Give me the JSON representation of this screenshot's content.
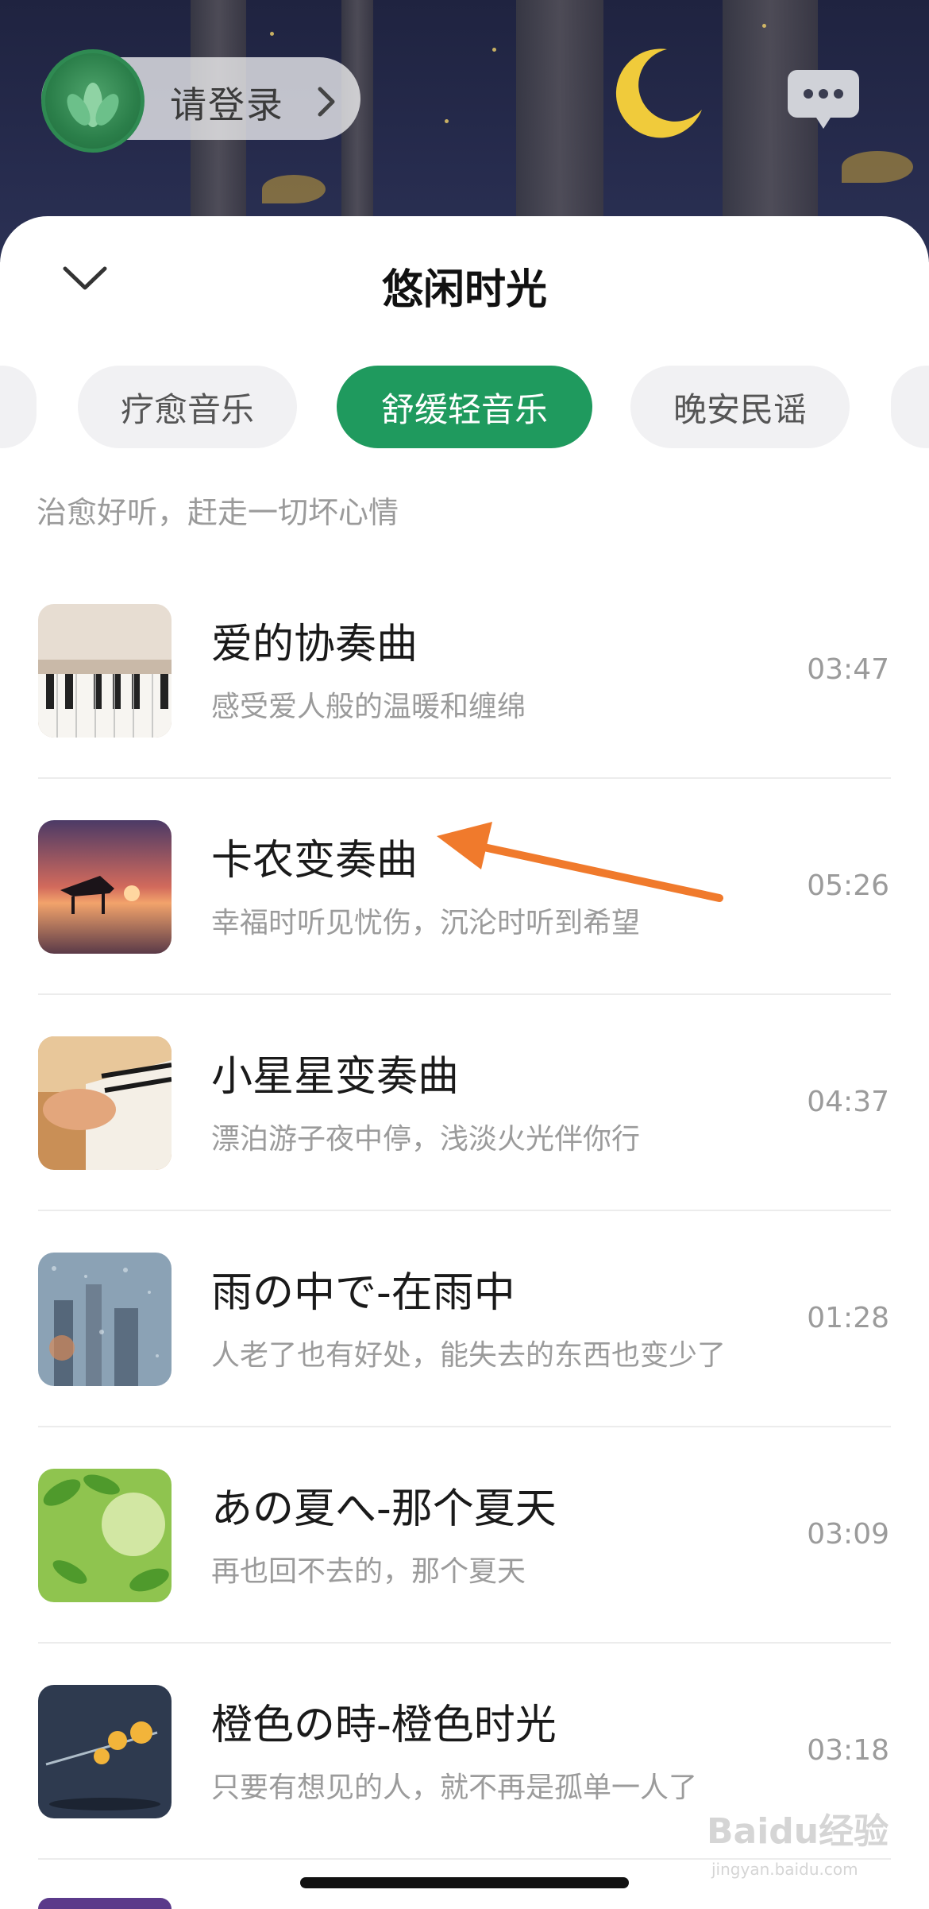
{
  "header": {
    "login_label": "请登录",
    "icons": [
      "lotus-avatar-icon",
      "chevron-right-icon",
      "message-icon",
      "moon-icon"
    ]
  },
  "sheet": {
    "title": "悠闲时光",
    "collapse_icon": "chevron-down-icon"
  },
  "tabs": [
    {
      "label": "",
      "active": false
    },
    {
      "label": "疗愈音乐",
      "active": false
    },
    {
      "label": "舒缓轻音乐",
      "active": true
    },
    {
      "label": "晚安民谣",
      "active": false
    },
    {
      "label": "",
      "active": false
    }
  ],
  "category_subtitle": "治愈好听，赶走一切坏心情",
  "songs": [
    {
      "title": "爱的协奏曲",
      "desc": "感受爱人般的温暖和缠绵",
      "duration": "03:47"
    },
    {
      "title": "卡农变奏曲",
      "desc": "幸福时听见忧伤，沉沦时听到希望",
      "duration": "05:26"
    },
    {
      "title": "小星星变奏曲",
      "desc": "漂泊游子夜中停，浅淡火光伴你行",
      "duration": "04:37"
    },
    {
      "title": "雨の中で-在雨中",
      "desc": "人老了也有好处，能失去的东西也变少了",
      "duration": "01:28"
    },
    {
      "title": "あの夏へ-那个夏天",
      "desc": "再也回不去的，那个夏天",
      "duration": "03:09"
    },
    {
      "title": "橙色の時-橙色时光",
      "desc": "只要有想见的人，就不再是孤单一人了",
      "duration": "03:18"
    }
  ],
  "annotation": {
    "type": "arrow",
    "color": "#f07a2c"
  },
  "watermark": {
    "brand": "Baidu经验",
    "url": "jingyan.baidu.com"
  },
  "colors": {
    "accent": "#1f9a5e",
    "night_bg": "#262b4d"
  }
}
